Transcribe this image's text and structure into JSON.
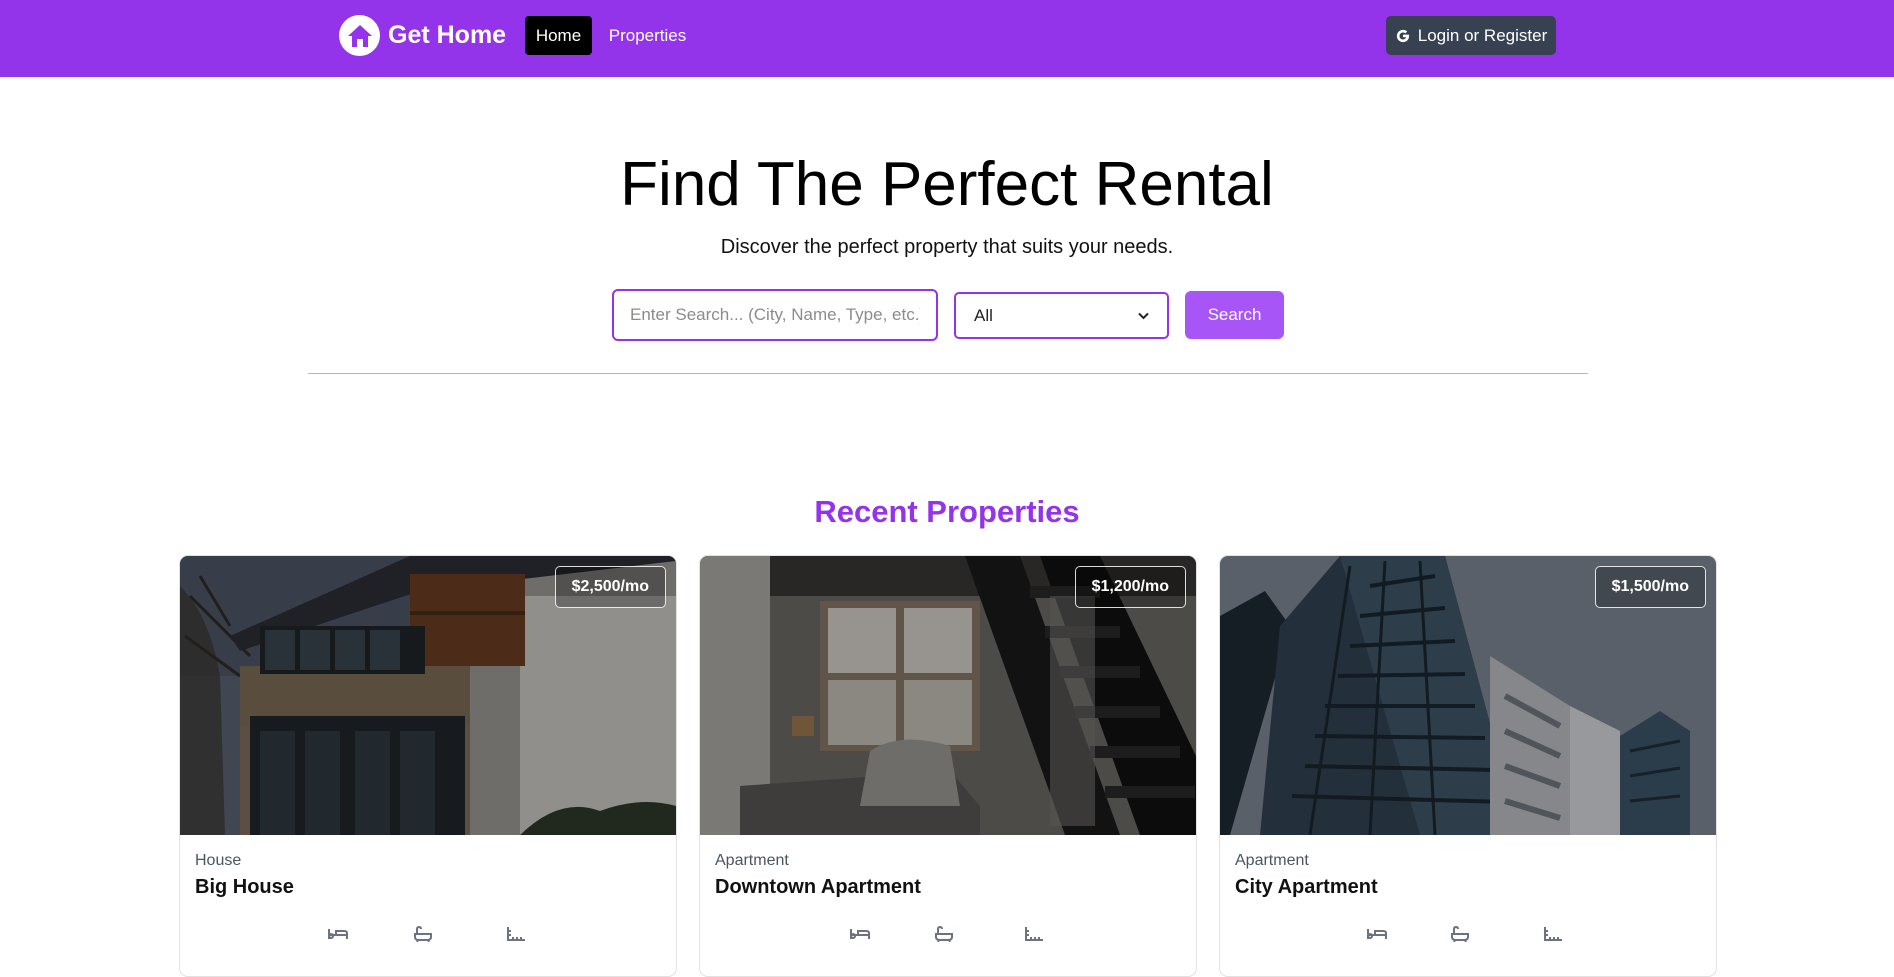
{
  "navbar": {
    "brand": "Get Home",
    "links": [
      {
        "label": "Home",
        "active": true
      },
      {
        "label": "Properties",
        "active": false
      }
    ],
    "login_label": "Login or Register",
    "bg_color": "#9333ea"
  },
  "hero": {
    "title": "Find The Perfect Rental",
    "subtitle": "Discover the perfect property that suits your needs."
  },
  "search": {
    "placeholder": "Enter Search... (City, Name, Type, etc.)",
    "value": "",
    "type_selected": "All",
    "button_label": "Search"
  },
  "recent": {
    "title": "Recent Properties",
    "cards": [
      {
        "type": "House",
        "name": "Big House",
        "price": "$2,500/mo"
      },
      {
        "type": "Apartment",
        "name": "Downtown Apartment",
        "price": "$1,200/mo"
      },
      {
        "type": "Apartment",
        "name": "City Apartment",
        "price": "$1,500/mo"
      }
    ]
  },
  "icons": [
    "home-icon",
    "google-icon",
    "bed-icon",
    "bath-icon",
    "ruler-icon",
    "chevron-down-icon"
  ]
}
